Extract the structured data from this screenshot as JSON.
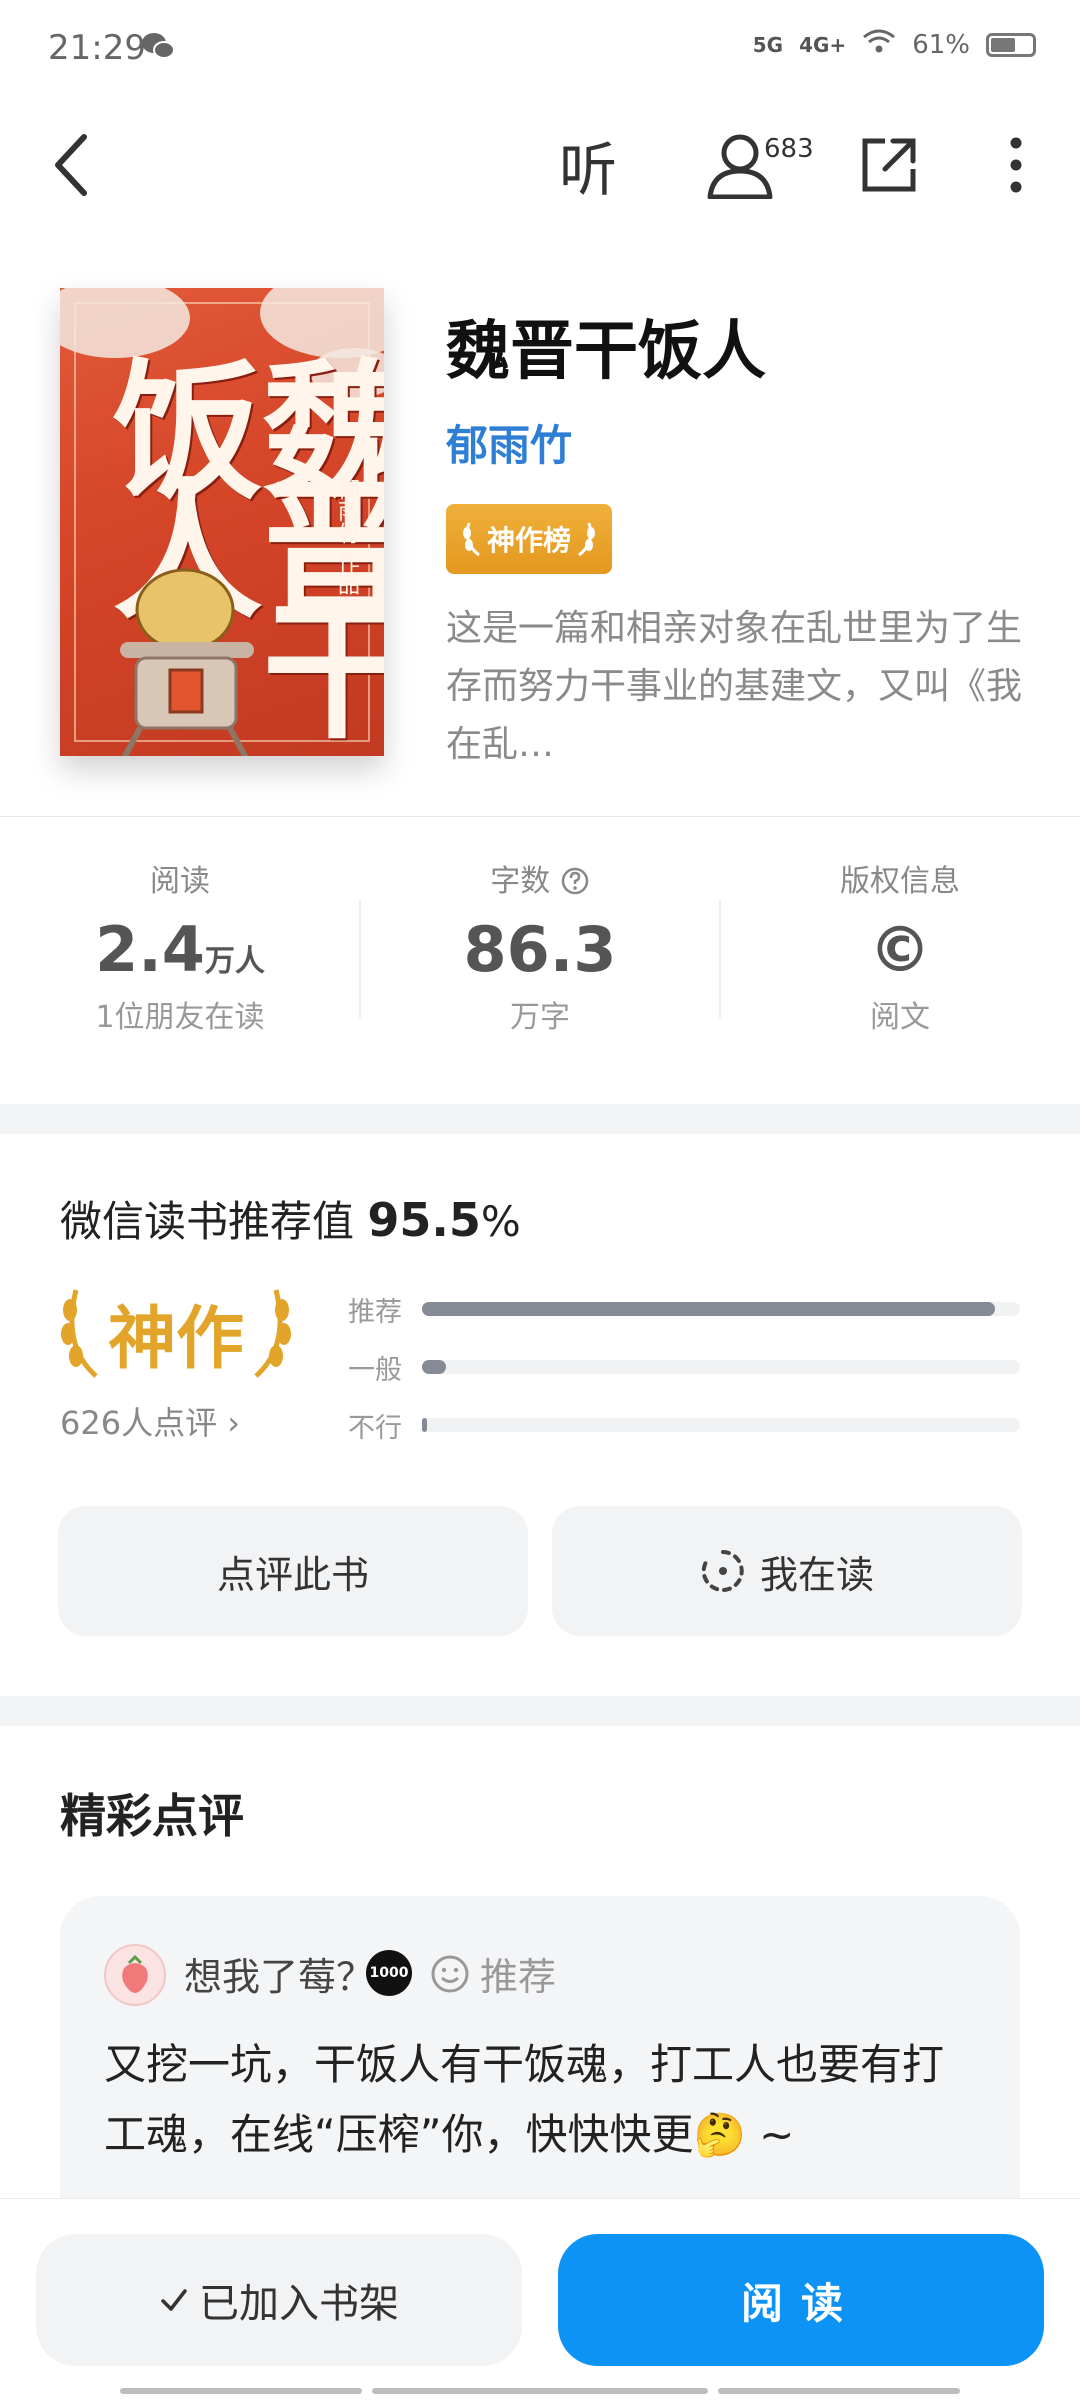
{
  "status_bar": {
    "time": "21:29",
    "battery": "61%",
    "signal1": "5G",
    "signal2": "4G+",
    "battery_level": 0.61
  },
  "top_bar": {
    "listen_label": "听",
    "listeners_count": "683"
  },
  "book": {
    "title": "魏晋干饭人",
    "author": "郁雨竹",
    "badge": "神作榜",
    "synopsis": "这是一篇和相亲对象在乱世里为了生存而努力干事业的基建文，又叫《我在乱…",
    "cover_title": "魏晋干饭人",
    "cover_author": "郁雨竹 作品"
  },
  "stats": {
    "reading": {
      "label": "阅读",
      "value": "2.4",
      "unit": "万人",
      "sub": "1位朋友在读"
    },
    "words": {
      "label": "字数",
      "value": "86.3",
      "sub": "万字"
    },
    "copyright": {
      "label": "版权信息",
      "value": "©",
      "sub": "阅文"
    }
  },
  "rating": {
    "title": "微信读书推荐值",
    "value": "95.5",
    "percent_sign": "%",
    "level": "神作",
    "reviews_link": "626人点评",
    "bars": [
      {
        "label": "推荐",
        "fraction": 0.958
      },
      {
        "label": "一般",
        "fraction": 0.04
      },
      {
        "label": "不行",
        "fraction": 0.006
      }
    ]
  },
  "actions": {
    "review_button": "点评此书",
    "reading_button": "我在读"
  },
  "reviews": {
    "section_title": "精彩点评",
    "items": [
      {
        "user": "想我了莓？",
        "level_badge": "1000",
        "tag": "推荐",
        "text": "又挖一坑，干饭人有干饭魂，打工人也要有打工魂，在线“压榨”你，快快快更🤔 ~"
      }
    ]
  },
  "bottom": {
    "shelf_button": "已加入书架",
    "read_button": "阅读"
  },
  "colors": {
    "accent_blue": "#0d92f5",
    "gold": "#e2a52a",
    "author_blue": "#2f7ed6"
  }
}
